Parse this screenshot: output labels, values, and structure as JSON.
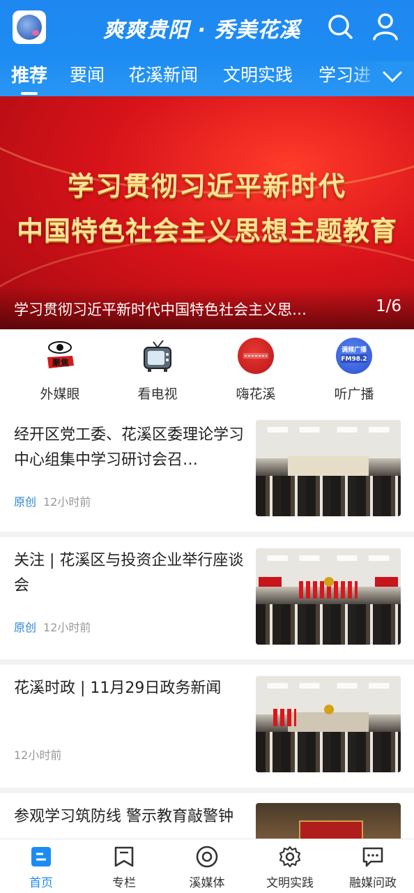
{
  "header": {
    "slogan": "爽爽贵阳 · 秀美花溪",
    "logo_icon": "app-logo",
    "search_icon": "search-icon",
    "user_icon": "user-icon",
    "brand_color": "#1d8cf2"
  },
  "tabs": [
    {
      "label": "推荐",
      "active": true
    },
    {
      "label": "要闻"
    },
    {
      "label": "花溪新闻"
    },
    {
      "label": "文明实践"
    },
    {
      "label": "学习进"
    }
  ],
  "banner": {
    "line1": "学习贯彻习近平新时代",
    "line2": "中国特色社会主义思想主题教育",
    "caption": "学习贯彻习近平新时代中国特色社会主义思…",
    "counter": "1/6"
  },
  "quick_links": [
    {
      "label": "外媒眼",
      "icon": "eye-icon",
      "badge": "聚焦"
    },
    {
      "label": "看电视",
      "icon": "tv-icon"
    },
    {
      "label": "嗨花溪",
      "icon": "hi-huaxi-icon"
    },
    {
      "label": "听广播",
      "icon": "radio-icon",
      "badge": "调频广播",
      "badge2": "FM98.2"
    }
  ],
  "news": [
    {
      "title": "经开区党工委、花溪区委理论学习中心组集中学习研讨会召…",
      "tag": "原创",
      "time": "12小时前"
    },
    {
      "title": "关注 | 花溪区与投资企业举行座谈会",
      "tag": "原创",
      "time": "12小时前"
    },
    {
      "title": "花溪时政 | 11月29日政务新闻",
      "tag": "",
      "time": "12小时前"
    },
    {
      "title": "参观学习筑防线  警示教育敲警钟",
      "tag": "",
      "time": ""
    }
  ],
  "bottom_nav": [
    {
      "label": "首页",
      "icon": "home-icon",
      "active": true
    },
    {
      "label": "专栏",
      "icon": "column-icon"
    },
    {
      "label": "溪媒体",
      "icon": "media-icon"
    },
    {
      "label": "文明实践",
      "icon": "gear-icon"
    },
    {
      "label": "融媒问政",
      "icon": "chat-icon"
    }
  ]
}
